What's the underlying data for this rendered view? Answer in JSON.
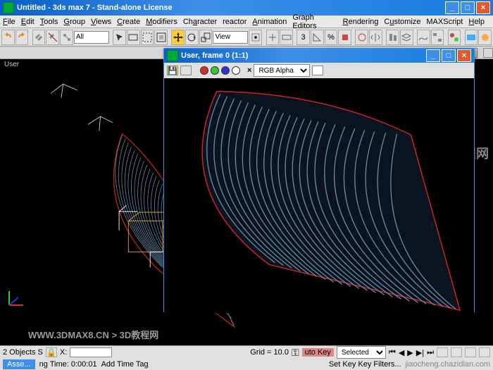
{
  "window": {
    "title": "Untitled - 3ds max 7 - Stand-alone License"
  },
  "menu": {
    "file": "File",
    "edit": "Edit",
    "tools": "Tools",
    "group": "Group",
    "views": "Views",
    "create": "Create",
    "modifiers": "Modifiers",
    "character": "Character",
    "reactor": "reactor",
    "animation": "Animation",
    "graph": "Graph Editors",
    "rendering": "Rendering",
    "customize": "Customize",
    "maxscript": "MAXScript",
    "help": "Help"
  },
  "toolbar": {
    "filter": "All",
    "viewmode": "View"
  },
  "viewport": {
    "label": "User"
  },
  "render_window": {
    "title": "User, frame 0 (1:1)",
    "channel": "RGB Alpha"
  },
  "status": {
    "objects": "2 Objects S",
    "x_label": "X:",
    "grid": "Grid = 10.0",
    "autokey": "uto Key",
    "selected": "Selected",
    "time": "ng Time: 0:00:01",
    "addtag": "Add Time Tag",
    "setkey": "Set Key Key Filters..."
  },
  "watermarks": {
    "url": "WWW.3DMAX8.CN > 3D教程网",
    "right_big": "查字典 教程网",
    "right_small": "jiaocheng.chazidian.com"
  },
  "taskbtn": "Asse..."
}
